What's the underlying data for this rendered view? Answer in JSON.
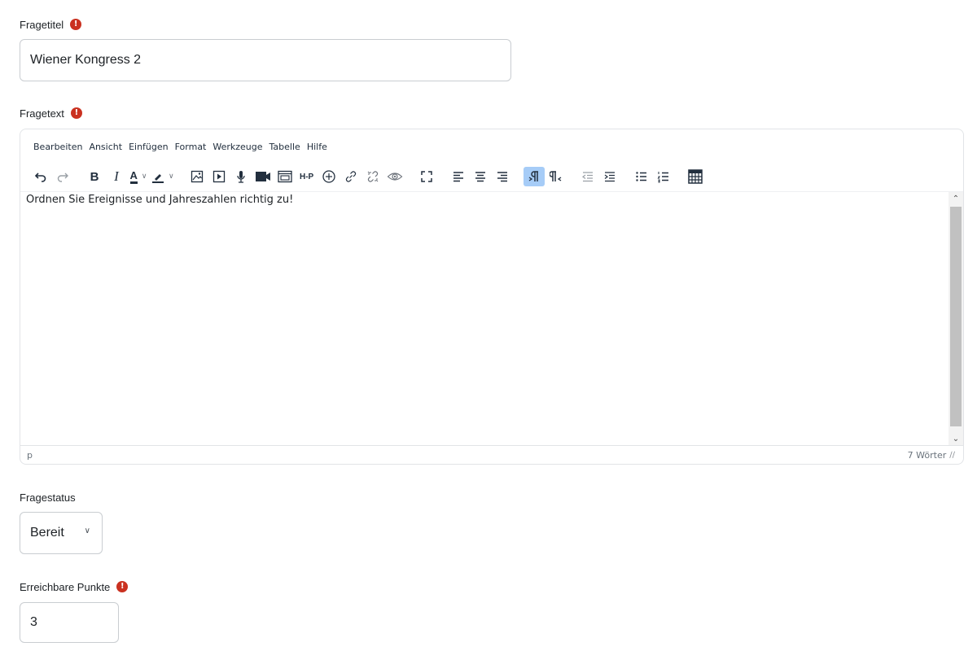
{
  "title_field": {
    "label": "Fragetitel",
    "required_mark": "!",
    "value": "Wiener Kongress 2"
  },
  "text_field": {
    "label": "Fragetext",
    "required_mark": "!",
    "menu": [
      "Bearbeiten",
      "Ansicht",
      "Einfügen",
      "Format",
      "Werkzeuge",
      "Tabelle",
      "Hilfe"
    ],
    "toolbar_icons": [
      "undo-icon",
      "redo-icon",
      "bold-icon",
      "italic-icon",
      "text-color-icon",
      "highlight-color-icon",
      "image-icon",
      "media-icon",
      "record-audio-icon",
      "record-video-icon",
      "embed-icon",
      "h5p-icon",
      "accessibility-icon",
      "link-icon",
      "unlink-icon",
      "preview-icon",
      "fullscreen-icon",
      "align-left-icon",
      "align-center-icon",
      "align-right-icon",
      "ltr-icon",
      "rtl-icon",
      "outdent-icon",
      "indent-icon",
      "bullet-list-icon",
      "numbered-list-icon",
      "calculator-icon"
    ],
    "toolbar_glyphs": {
      "bold": "B",
      "italic": "I",
      "text_color": "A",
      "h5p": "H-P"
    },
    "content": "Ordnen Sie Ereignisse und Jahreszahlen richtig zu!",
    "status_path": "p",
    "word_count": "7 Wörter",
    "accent_color": "#a6ccf7"
  },
  "status_field": {
    "label": "Fragestatus",
    "selected": "Bereit"
  },
  "points_field": {
    "label": "Erreichbare Punkte",
    "required_mark": "!",
    "value": "3"
  },
  "colors": {
    "required": "#ca3120",
    "border": "#c9cdd1",
    "text": "#1d2125"
  }
}
